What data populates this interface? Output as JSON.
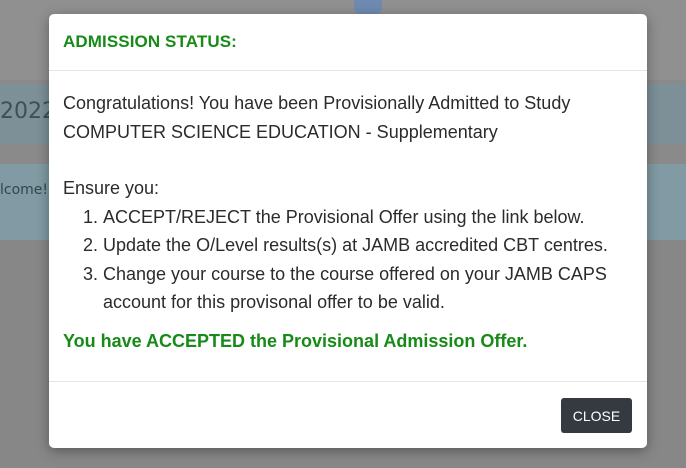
{
  "background": {
    "year_fragment": "2022",
    "welcome_fragment": "lcome!"
  },
  "modal": {
    "title": "ADMISSION STATUS:",
    "congrats_line1": "Congratulations! You have been Provisionally Admitted to Study",
    "congrats_line2": "COMPUTER SCIENCE EDUCATION - Supplementary",
    "ensure_label": "Ensure you:",
    "steps": [
      "ACCEPT/REJECT the Provisional Offer using the link below.",
      "Update the O/Level results(s) at JAMB accredited CBT centres.",
      "Change your course to the course offered on your JAMB CAPS account for this provisonal offer to be valid."
    ],
    "status_message": "You have ACCEPTED the Provisional Admission Offer.",
    "close_label": "CLOSE"
  },
  "colors": {
    "title_green": "#178a17",
    "button_dark": "#343a40"
  }
}
